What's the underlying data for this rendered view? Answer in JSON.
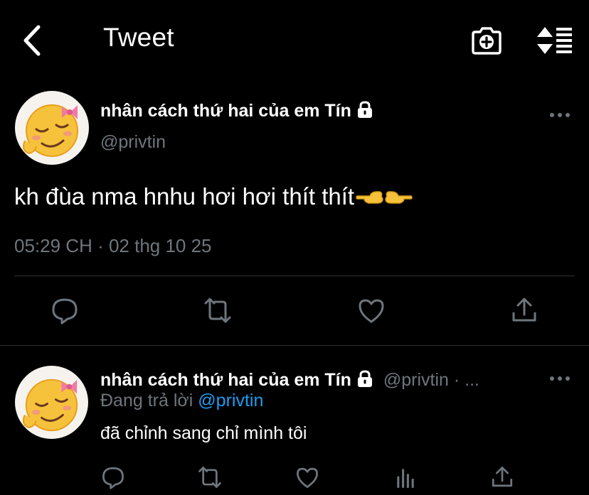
{
  "header": {
    "title": "Tweet",
    "back_icon": "chevron-left-icon",
    "camera_icon": "camera-plus-icon",
    "sort_icon": "sort-icon"
  },
  "tweet": {
    "display_name": "nhân cách thứ hai của em Tín",
    "handle": "@privtin",
    "text": "kh đùa nma hnhu hơi hơi thít thít",
    "timestamp": "05:29 CH · 02 thg 10 25",
    "actions": [
      "reply-icon",
      "retweet-icon",
      "like-icon",
      "share-icon"
    ]
  },
  "reply": {
    "display_name": "nhân cách thứ hai của em Tín",
    "handle_suffix": "@privtin · ...",
    "replying_prefix": "Đang trả lời",
    "replying_to": "@privtin",
    "text": "đã chỉnh sang chỉ mình tôi",
    "actions": [
      "reply-icon",
      "retweet-icon",
      "like-icon",
      "stats-icon",
      "share-icon"
    ]
  },
  "colors": {
    "background": "#000000",
    "text": "#ffffff",
    "secondary": "#6e767d",
    "accent": "#1d9bf0",
    "divider": "#2f3336"
  }
}
